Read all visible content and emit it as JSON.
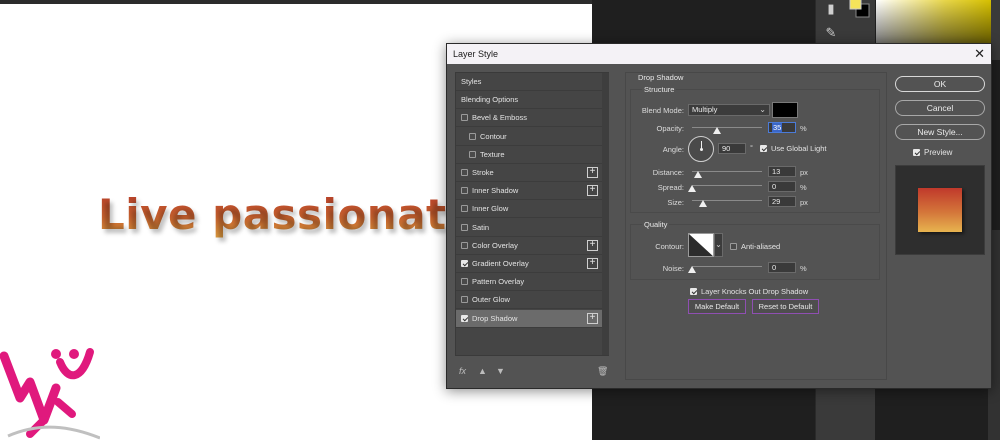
{
  "canvas": {
    "headline": "Live passionately"
  },
  "dialog": {
    "title": "Layer Style",
    "close_glyph": "✕",
    "styles_list": [
      {
        "label": "Styles",
        "checkbox": false,
        "checked": false,
        "plus": false,
        "indent": false,
        "selected": false
      },
      {
        "label": "Blending Options",
        "checkbox": false,
        "checked": false,
        "plus": false,
        "indent": false,
        "selected": false
      },
      {
        "label": "Bevel & Emboss",
        "checkbox": true,
        "checked": false,
        "plus": false,
        "indent": false,
        "selected": false
      },
      {
        "label": "Contour",
        "checkbox": true,
        "checked": false,
        "plus": false,
        "indent": true,
        "selected": false
      },
      {
        "label": "Texture",
        "checkbox": true,
        "checked": false,
        "plus": false,
        "indent": true,
        "selected": false
      },
      {
        "label": "Stroke",
        "checkbox": true,
        "checked": false,
        "plus": true,
        "indent": false,
        "selected": false
      },
      {
        "label": "Inner Shadow",
        "checkbox": true,
        "checked": false,
        "plus": true,
        "indent": false,
        "selected": false
      },
      {
        "label": "Inner Glow",
        "checkbox": true,
        "checked": false,
        "plus": false,
        "indent": false,
        "selected": false
      },
      {
        "label": "Satin",
        "checkbox": true,
        "checked": false,
        "plus": false,
        "indent": false,
        "selected": false
      },
      {
        "label": "Color Overlay",
        "checkbox": true,
        "checked": false,
        "plus": true,
        "indent": false,
        "selected": false
      },
      {
        "label": "Gradient Overlay",
        "checkbox": true,
        "checked": true,
        "plus": true,
        "indent": false,
        "selected": false
      },
      {
        "label": "Pattern Overlay",
        "checkbox": true,
        "checked": false,
        "plus": false,
        "indent": false,
        "selected": false
      },
      {
        "label": "Outer Glow",
        "checkbox": true,
        "checked": false,
        "plus": false,
        "indent": false,
        "selected": false
      },
      {
        "label": "Drop Shadow",
        "checkbox": true,
        "checked": true,
        "plus": true,
        "indent": false,
        "selected": true
      }
    ],
    "footer_icons": [
      "fx-icon",
      "move-up-icon",
      "move-down-icon",
      "trash-icon"
    ],
    "footer_fx": "fx",
    "drop_shadow": {
      "section_title": "Drop Shadow",
      "structure_title": "Structure",
      "blend_mode_label": "Blend Mode:",
      "blend_mode_value": "Multiply",
      "shadow_color": "#000000",
      "opacity_label": "Opacity:",
      "opacity_value": "35",
      "opacity_unit": "%",
      "opacity_level": 0.35,
      "angle_label": "Angle:",
      "angle_value": "90",
      "angle_unit": "°",
      "use_global_light_label": "Use Global Light",
      "use_global_light_checked": true,
      "distance_label": "Distance:",
      "distance_value": "13",
      "distance_unit": "px",
      "spread_label": "Spread:",
      "spread_value": "0",
      "spread_unit": "%",
      "size_label": "Size:",
      "size_value": "29",
      "size_unit": "px",
      "quality_title": "Quality",
      "contour_label": "Contour:",
      "anti_aliased_label": "Anti-aliased",
      "anti_aliased_checked": false,
      "noise_label": "Noise:",
      "noise_value": "0",
      "noise_unit": "%",
      "knocks_out_label": "Layer Knocks Out Drop Shadow",
      "knocks_out_checked": true,
      "make_default_label": "Make Default",
      "reset_default_label": "Reset to Default"
    },
    "buttons": {
      "ok": "OK",
      "cancel": "Cancel",
      "new_style": "New Style..."
    },
    "preview_label": "Preview",
    "preview_checked": true
  }
}
